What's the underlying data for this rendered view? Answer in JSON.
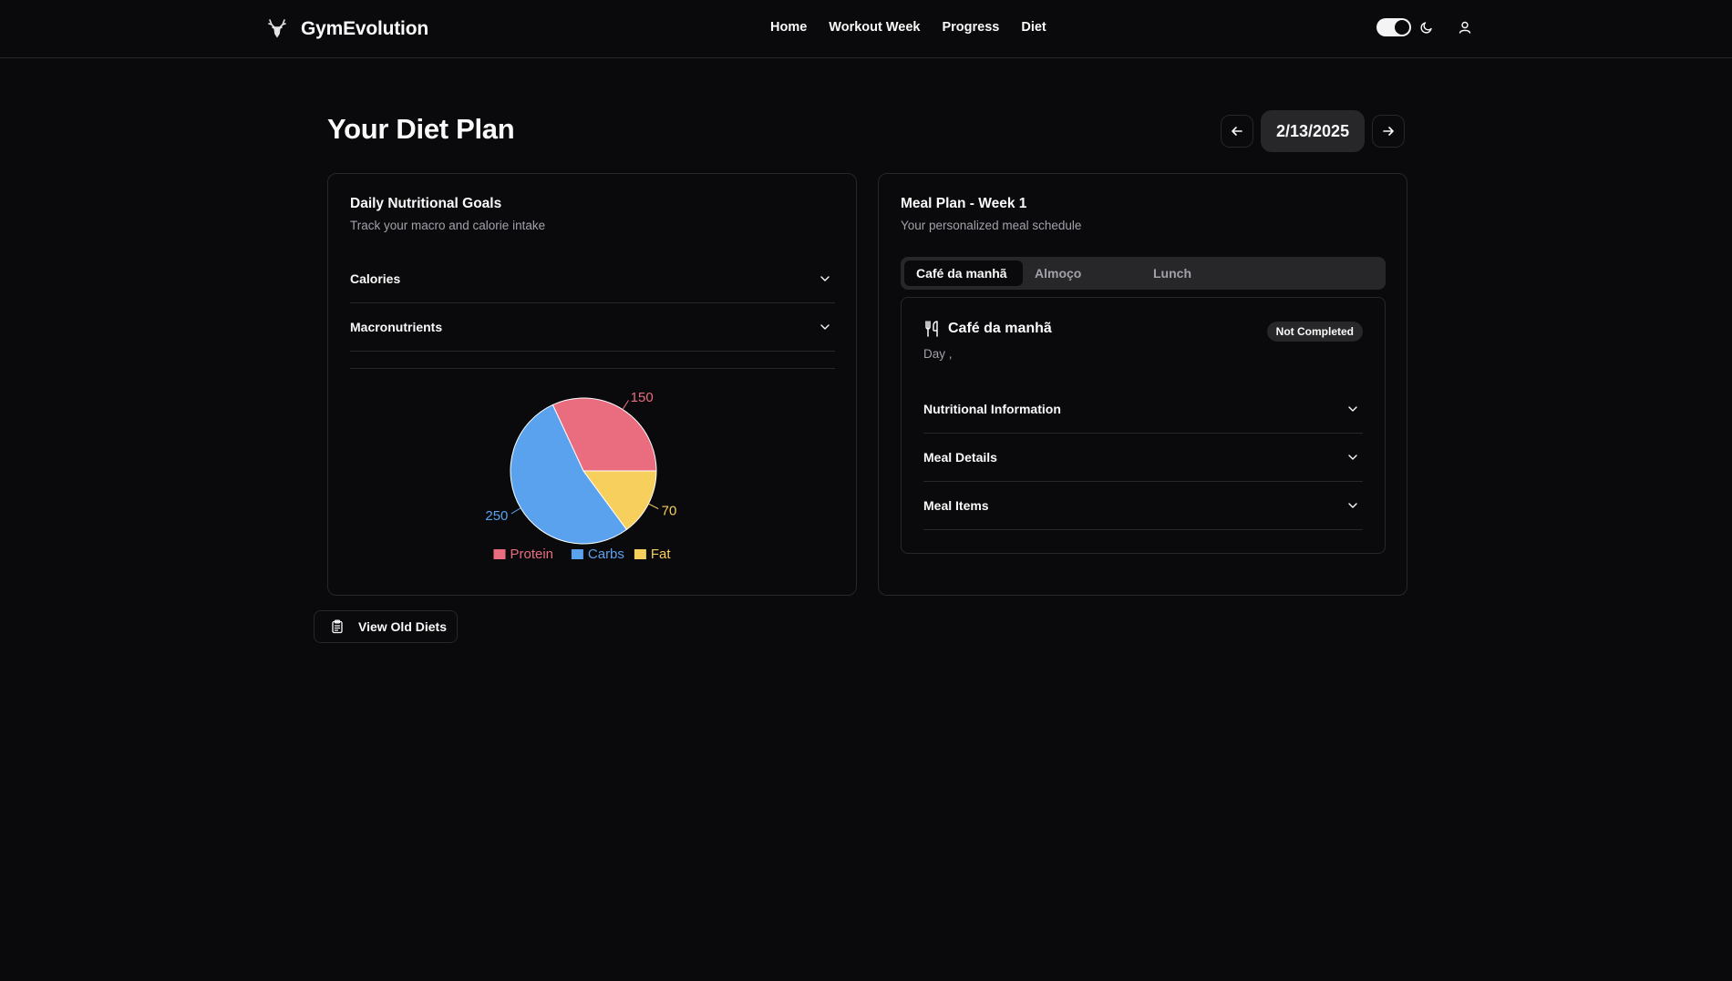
{
  "brand": {
    "name": "GymEvolution",
    "logo_icon": "deer-head-icon"
  },
  "nav": {
    "items": [
      "Home",
      "Workout Week",
      "Progress",
      "Diet"
    ]
  },
  "header": {
    "theme_toggle": "dark",
    "moon_icon": "moon-icon",
    "user_icon": "user-icon"
  },
  "page": {
    "title": "Your Diet Plan",
    "date": "2/13/2025"
  },
  "nutrition_card": {
    "title": "Daily Nutritional Goals",
    "subtitle": "Track your macro and calorie intake",
    "accordions": [
      "Calories",
      "Macronutrients"
    ]
  },
  "chart_data": {
    "type": "pie",
    "categories": [
      "Protein",
      "Carbs",
      "Fat"
    ],
    "values": [
      150,
      250,
      70
    ],
    "data_labels": [
      "150",
      "250",
      "70"
    ],
    "colors": [
      "#e96d7f",
      "#5aa2ee",
      "#f7cf5c"
    ],
    "legend": "bottom"
  },
  "meal_card": {
    "title": "Meal Plan - Week 1",
    "subtitle": "Your personalized meal schedule",
    "tabs": [
      "Café da manhã",
      "Almoço",
      "Lunch"
    ],
    "active_tab": "Café da manhã",
    "meal_name": "Café da manhã",
    "meal_icon": "utensils-icon",
    "meal_sub": "Day ,",
    "status": "Not Completed",
    "accordions": [
      "Nutritional Information",
      "Meal Details",
      "Meal Items"
    ]
  },
  "old_diets_button": {
    "label": "View Old Diets",
    "icon": "clipboard-icon"
  }
}
